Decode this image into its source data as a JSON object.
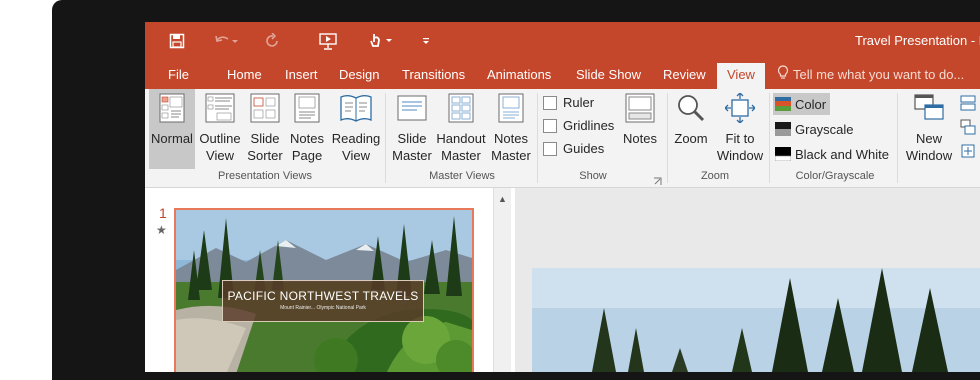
{
  "window": {
    "title": "Travel Presentation - P"
  },
  "tabs": {
    "file": "File",
    "home": "Home",
    "insert": "Insert",
    "design": "Design",
    "transitions": "Transitions",
    "animations": "Animations",
    "slide_show": "Slide Show",
    "review": "Review",
    "view": "View",
    "tell_me": "Tell me what you want to do..."
  },
  "ribbon": {
    "presentation_views": {
      "label": "Presentation Views",
      "normal": "Normal",
      "outline_view": [
        "Outline",
        "View"
      ],
      "slide_sorter": [
        "Slide",
        "Sorter"
      ],
      "notes_page": [
        "Notes",
        "Page"
      ],
      "reading_view": [
        "Reading",
        "View"
      ]
    },
    "master_views": {
      "label": "Master Views",
      "slide_master": [
        "Slide",
        "Master"
      ],
      "handout_master": [
        "Handout",
        "Master"
      ],
      "notes_master": [
        "Notes",
        "Master"
      ]
    },
    "show": {
      "label": "Show",
      "ruler": "Ruler",
      "gridlines": "Gridlines",
      "guides": "Guides",
      "notes": "Notes"
    },
    "zoom": {
      "label": "Zoom",
      "zoom": "Zoom",
      "fit_to_window": [
        "Fit to",
        "Window"
      ]
    },
    "color_grayscale": {
      "label": "Color/Grayscale",
      "color": "Color",
      "grayscale": "Grayscale",
      "black_and_white": "Black and White"
    },
    "window": {
      "new_window": [
        "New",
        "Window"
      ]
    }
  },
  "slides_pane": {
    "slide_number": "1",
    "star": "★",
    "thumbnail_title": "PACIFIC NORTHWEST TRAVELS",
    "thumbnail_subtitle": "Mount Rainier... Olympic National Park"
  },
  "colors": {
    "accent": "#c4462b",
    "ribbon_bg": "#f3f3f3",
    "selected": "#c8c8c8"
  }
}
